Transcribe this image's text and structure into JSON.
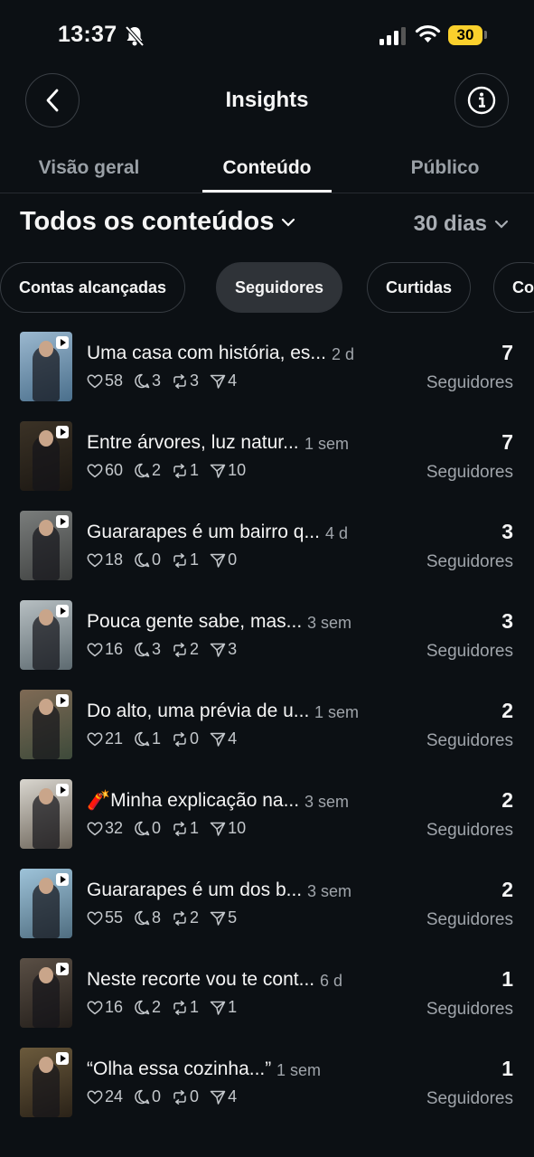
{
  "status_bar": {
    "time": "13:37",
    "battery": "30"
  },
  "header": {
    "title": "Insights"
  },
  "tabs": [
    {
      "label": "Visão geral",
      "active": false
    },
    {
      "label": "Conteúdo",
      "active": true
    },
    {
      "label": "Público",
      "active": false
    }
  ],
  "filters": {
    "content_type": "Todos os conteúdos",
    "period": "30 dias"
  },
  "chips": [
    {
      "label": "Contas alcançadas",
      "active": false
    },
    {
      "label": "Seguidores",
      "active": true
    },
    {
      "label": "Curtidas",
      "active": false
    },
    {
      "label": "Co",
      "active": false
    }
  ],
  "unit_label": "Seguidores",
  "posts": [
    {
      "title": "Uma casa com história, es...",
      "age": "2 d",
      "likes": "58",
      "comments": "3",
      "reposts": "3",
      "shares": "4",
      "value": "7",
      "thumb": [
        "#9bb8cf",
        "#4a6f8c"
      ]
    },
    {
      "title": "Entre árvores, luz natur...",
      "age": "1 sem",
      "likes": "60",
      "comments": "2",
      "reposts": "1",
      "shares": "10",
      "value": "7",
      "thumb": [
        "#3b3226",
        "#1b1712"
      ]
    },
    {
      "title": "Guararapes é um bairro q...",
      "age": "4 d",
      "likes": "18",
      "comments": "0",
      "reposts": "1",
      "shares": "0",
      "value": "3",
      "thumb": [
        "#7a7d7c",
        "#3f4140"
      ]
    },
    {
      "title": "Pouca gente sabe, mas...",
      "age": "3 sem",
      "likes": "16",
      "comments": "3",
      "reposts": "2",
      "shares": "3",
      "value": "3",
      "thumb": [
        "#b7bfc2",
        "#5d6a70"
      ]
    },
    {
      "title": "Do alto, uma prévia de u...",
      "age": "1 sem",
      "likes": "21",
      "comments": "1",
      "reposts": "0",
      "shares": "4",
      "value": "2",
      "thumb": [
        "#7f6a55",
        "#3d4a3a"
      ]
    },
    {
      "title": "🧨Minha explicação na...",
      "age": "3 sem",
      "likes": "32",
      "comments": "0",
      "reposts": "1",
      "shares": "10",
      "value": "2",
      "thumb": [
        "#d9d6cf",
        "#6b6358"
      ]
    },
    {
      "title": "Guararapes é um dos b...",
      "age": "3 sem",
      "likes": "55",
      "comments": "8",
      "reposts": "2",
      "shares": "5",
      "value": "2",
      "thumb": [
        "#9ec3d9",
        "#4f6d80"
      ]
    },
    {
      "title": "Neste recorte vou te cont...",
      "age": "6 d",
      "likes": "16",
      "comments": "2",
      "reposts": "1",
      "shares": "1",
      "value": "1",
      "thumb": [
        "#5a4f45",
        "#231e1a"
      ]
    },
    {
      "title": "“Olha essa cozinha...”",
      "age": "1 sem",
      "likes": "24",
      "comments": "0",
      "reposts": "0",
      "shares": "4",
      "value": "1",
      "thumb": [
        "#6b5a3c",
        "#2a2218"
      ]
    }
  ]
}
